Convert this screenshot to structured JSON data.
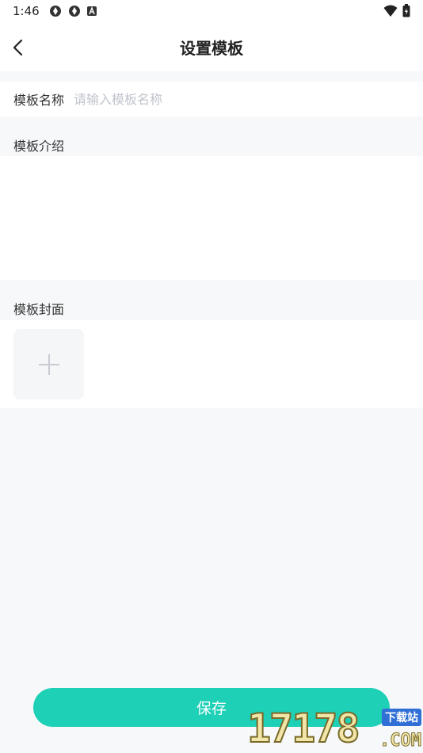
{
  "status_bar": {
    "time": "1:46",
    "icons": [
      "app-icon-1",
      "app-icon-2",
      "a-icon"
    ],
    "right_icons": [
      "wifi-icon",
      "battery-icon"
    ]
  },
  "header": {
    "title": "设置模板",
    "back_icon": "chevron-left-icon"
  },
  "form": {
    "name_label": "模板名称",
    "name_placeholder": "请输入模板名称",
    "name_value": "",
    "intro_label": "模板介绍",
    "intro_value": "",
    "cover_label": "模板封面",
    "cover_add_icon": "plus-icon"
  },
  "footer": {
    "save_label": "保存"
  },
  "watermark": {
    "digits": "17178",
    "tag": "下载站",
    "domain": ".COM"
  },
  "colors": {
    "accent": "#1dd0b6",
    "background": "#f7f8fa",
    "placeholder": "#c0c4cc"
  }
}
